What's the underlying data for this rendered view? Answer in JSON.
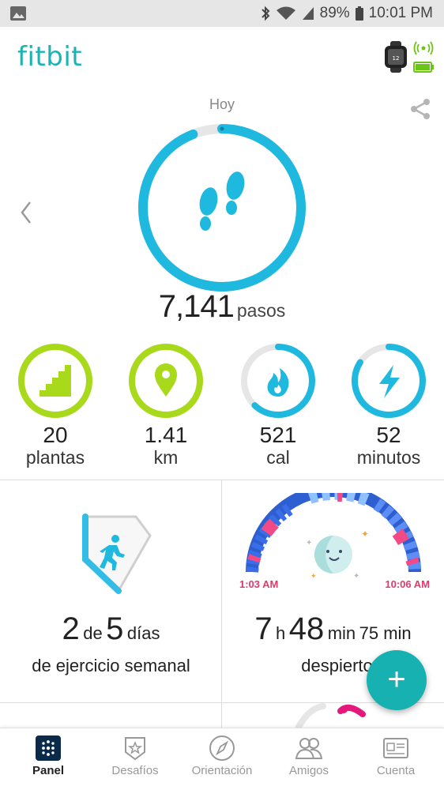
{
  "status_bar": {
    "battery": "89%",
    "time": "10:01 PM"
  },
  "header": {
    "logo": "fitbit"
  },
  "day_label": "Hoy",
  "steps": {
    "value": "7,141",
    "unit": "pasos",
    "progress": 0.94
  },
  "stats": [
    {
      "value": "20",
      "unit": "plantas",
      "icon": "stairs-icon",
      "progress": 1.0,
      "color": "#a8d91b"
    },
    {
      "value": "1.41",
      "unit": "km",
      "icon": "location-pin-icon",
      "progress": 1.0,
      "color": "#a8d91b"
    },
    {
      "value": "521",
      "unit": "cal",
      "icon": "flame-icon",
      "progress": 0.62,
      "color": "#1fb9e0"
    },
    {
      "value": "52",
      "unit": "minutos",
      "icon": "lightning-icon",
      "progress": 0.84,
      "color": "#1fb9e0"
    }
  ],
  "exercise": {
    "done": "2",
    "of": "de",
    "goal": "5",
    "period": "días",
    "label": "de ejercicio semanal"
  },
  "sleep": {
    "start": "1:03 AM",
    "end": "10:06 AM",
    "hours": "7",
    "h_unit": "h",
    "minutes": "48",
    "min_unit": "min",
    "awake": "75 min",
    "awake_label": "despierto"
  },
  "fab_label": "+",
  "nav": [
    {
      "label": "Panel",
      "icon": "dashboard-icon",
      "active": true
    },
    {
      "label": "Desafíos",
      "icon": "challenges-icon"
    },
    {
      "label": "Orientación",
      "icon": "compass-icon"
    },
    {
      "label": "Amigos",
      "icon": "friends-icon"
    },
    {
      "label": "Cuenta",
      "icon": "account-card-icon"
    }
  ],
  "colors": {
    "brand": "#1cb3b3",
    "steps_ring": "#1fb9e0",
    "goal_green": "#a8d91b",
    "sleep_times": "#e03a6e"
  }
}
